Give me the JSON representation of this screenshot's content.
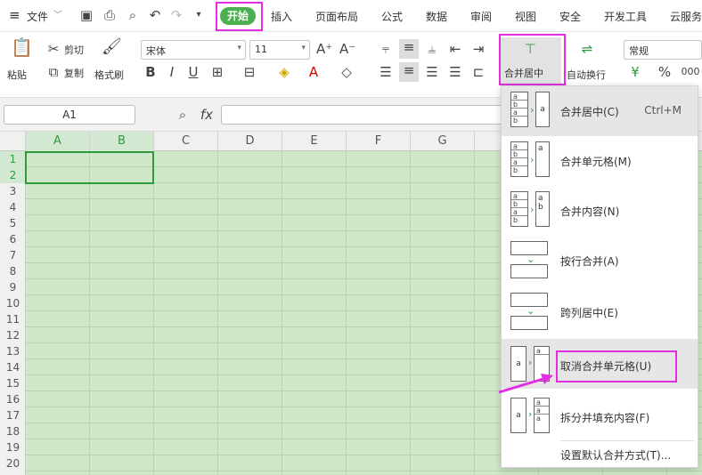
{
  "menubar": {
    "hamburger": "≡",
    "file": "文件",
    "start": "开始",
    "insert": "插入",
    "layout": "页面布局",
    "formula": "公式",
    "data": "数据",
    "review": "审阅",
    "view": "视图",
    "security": "安全",
    "devtools": "开发工具",
    "cloud": "云服务"
  },
  "ribbon": {
    "paste": "粘贴",
    "cut": "剪切",
    "copy": "复制",
    "format_painter": "格式刷",
    "font_name": "宋体",
    "font_size": "11",
    "bold": "B",
    "italic": "I",
    "underline": "U",
    "merge_center": "合并居中",
    "wrap": "自动换行",
    "number_format": "常规",
    "percent": "%",
    "thousand": "000",
    "currency": "¥"
  },
  "formula_bar": {
    "name_box": "A1",
    "fx": "fx",
    "value": ""
  },
  "columns": [
    "A",
    "B",
    "C",
    "D",
    "E",
    "F",
    "G"
  ],
  "rows": [
    "1",
    "2",
    "3",
    "4",
    "5",
    "6",
    "7",
    "8",
    "9",
    "10",
    "11",
    "12",
    "13",
    "14",
    "15",
    "16",
    "17",
    "18",
    "19",
    "20"
  ],
  "merge_menu": {
    "items": [
      {
        "label": "合并居中(C)",
        "shortcut": "Ctrl+M"
      },
      {
        "label": "合并单元格(M)",
        "shortcut": ""
      },
      {
        "label": "合并内容(N)",
        "shortcut": ""
      },
      {
        "label": "按行合并(A)",
        "shortcut": ""
      },
      {
        "label": "跨列居中(E)",
        "shortcut": ""
      },
      {
        "label": "取消合并单元格(U)",
        "shortcut": ""
      },
      {
        "label": "拆分并填充内容(F)",
        "shortcut": ""
      }
    ],
    "settings": "设置默认合并方式(T)...",
    "sample_a": "a",
    "sample_b": "b"
  },
  "colors": {
    "accent": "#2e9a3b",
    "highlight": "#e02ee0",
    "sheet_bg": "#cfe8c9"
  }
}
